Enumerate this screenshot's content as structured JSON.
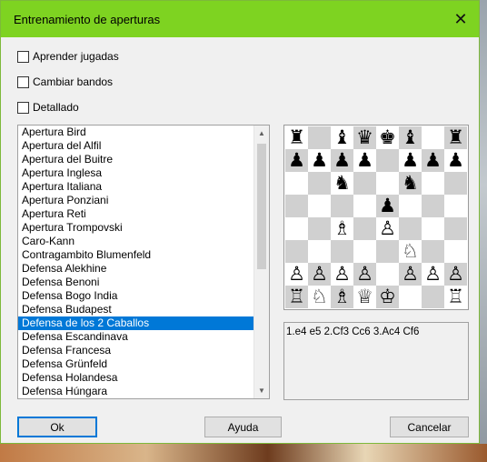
{
  "window": {
    "title": "Entrenamiento de aperturas",
    "close_glyph": "✕"
  },
  "options": [
    {
      "label": "Aprender jugadas",
      "checked": false
    },
    {
      "label": "Cambiar bandos",
      "checked": false
    },
    {
      "label": "Detallado",
      "checked": false
    }
  ],
  "openings": {
    "items": [
      "Apertura Bird",
      "Apertura del Alfil",
      "Apertura del Buitre",
      "Apertura Inglesa",
      "Apertura Italiana",
      "Apertura Ponziani",
      "Apertura Reti",
      "Apertura Trompovski",
      "Caro-Kann",
      "Contragambito Blumenfeld",
      "Defensa Alekhine",
      "Defensa Benoni",
      "Defensa Bogo India",
      "Defensa Budapest",
      "Defensa de los 2 Caballos",
      "Defensa Escandinava",
      "Defensa Francesa",
      "Defensa Grünfeld",
      "Defensa Holandesa",
      "Defensa Húngara"
    ],
    "selected_index": 14
  },
  "board": {
    "ranks": [
      "♜.♝♛♚♝.♜",
      "♟♟♟♟.♟♟♟",
      "..♞..♞..",
      "....♟...",
      "..♗.♙...",
      ".....♘..",
      "♙♙♙♙.♙♙♙",
      "♖♘♗♕♔..♖"
    ]
  },
  "moves_text": "1.e4 e5 2.Cf3 Cc6 3.Ac4 Cf6",
  "buttons": {
    "ok": "Ok",
    "help": "Ayuda",
    "cancel": "Cancelar"
  }
}
